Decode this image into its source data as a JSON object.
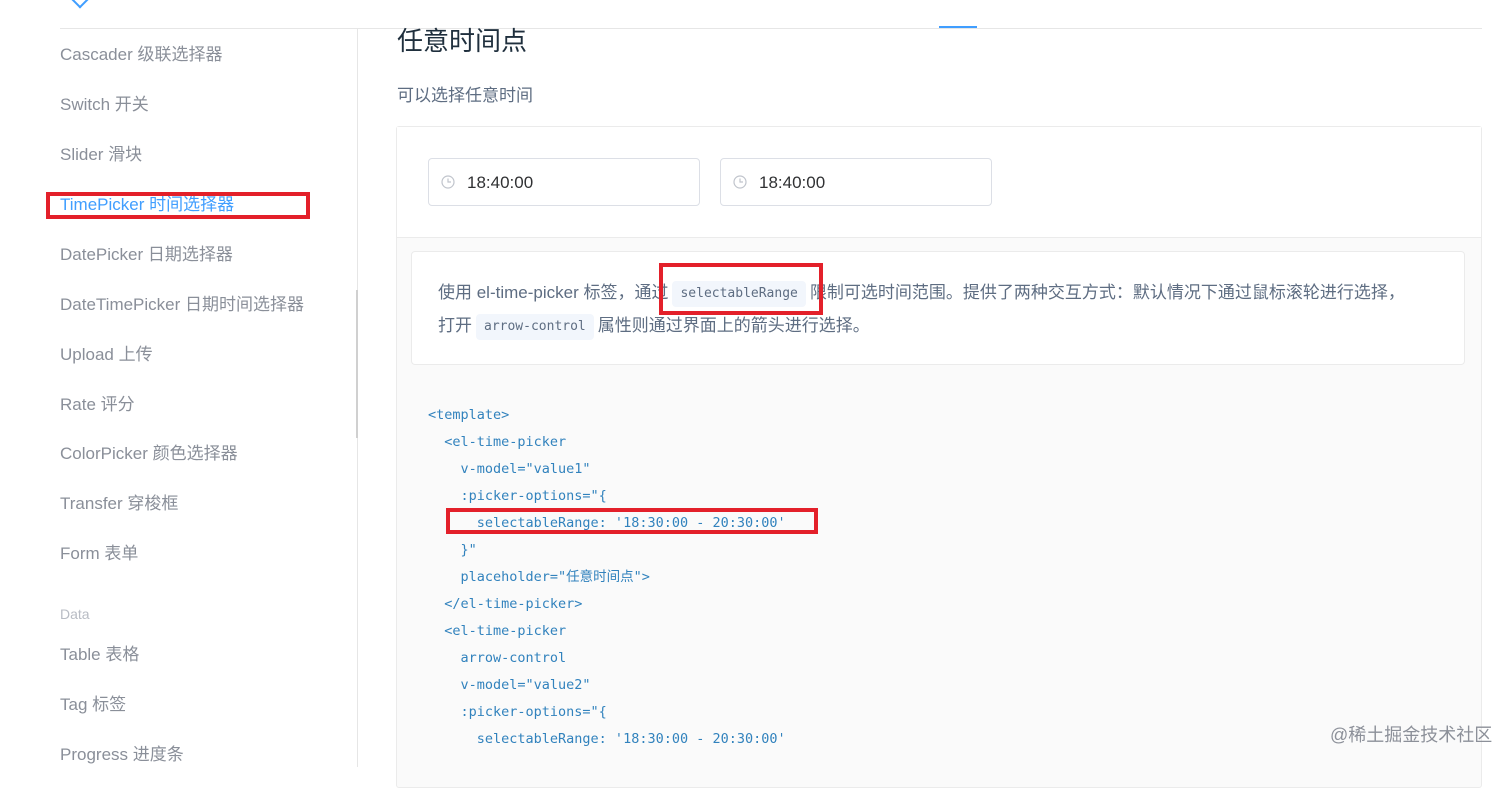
{
  "sidebar": {
    "items": [
      {
        "label": "Cascader 级联选择器"
      },
      {
        "label": "Switch 开关"
      },
      {
        "label": "Slider 滑块"
      },
      {
        "label": "TimePicker 时间选择器"
      },
      {
        "label": "DatePicker 日期选择器"
      },
      {
        "label": "DateTimePicker 日期时间选择器"
      },
      {
        "label": "Upload 上传"
      },
      {
        "label": "Rate 评分"
      },
      {
        "label": "ColorPicker 颜色选择器"
      },
      {
        "label": "Transfer 穿梭框"
      },
      {
        "label": "Form 表单"
      }
    ],
    "group_label": "Data",
    "data_items": [
      {
        "label": "Table 表格"
      },
      {
        "label": "Tag 标签"
      },
      {
        "label": "Progress 进度条"
      }
    ]
  },
  "section": {
    "title": "任意时间点",
    "description": "可以选择任意时间"
  },
  "demo": {
    "inputs": [
      {
        "value": "18:40:00",
        "icon": "clock-icon"
      },
      {
        "value": "18:40:00",
        "icon": "clock-icon"
      }
    ],
    "desc": {
      "line1_a": "使用 el-time-picker 标签，通过",
      "chip1": "selectableRange",
      "line1_b": "限制可选时间范围。提供了两种交互方式：默认情况下通过鼠标滚轮进行选择，",
      "line2_a": "打开",
      "chip2": "arrow-control",
      "line2_b": "属性则通过界面上的箭头进行选择。"
    },
    "code_lines": [
      "<template>",
      "  <el-time-picker",
      "    v-model=\"value1\"",
      "    :picker-options=\"{",
      "      selectableRange: '18:30:00 - 20:30:00'",
      "    }\"",
      "    placeholder=\"任意时间点\">",
      "  </el-time-picker>",
      "  <el-time-picker",
      "    arrow-control",
      "    v-model=\"value2\"",
      "    :picker-options=\"{",
      "      selectableRange: '18:30:00 - 20:30:00'"
    ]
  },
  "watermark": "@稀土掘金技术社区",
  "colors": {
    "accent": "#409eff",
    "highlight": "#e3202a",
    "code": "#3182bd"
  }
}
